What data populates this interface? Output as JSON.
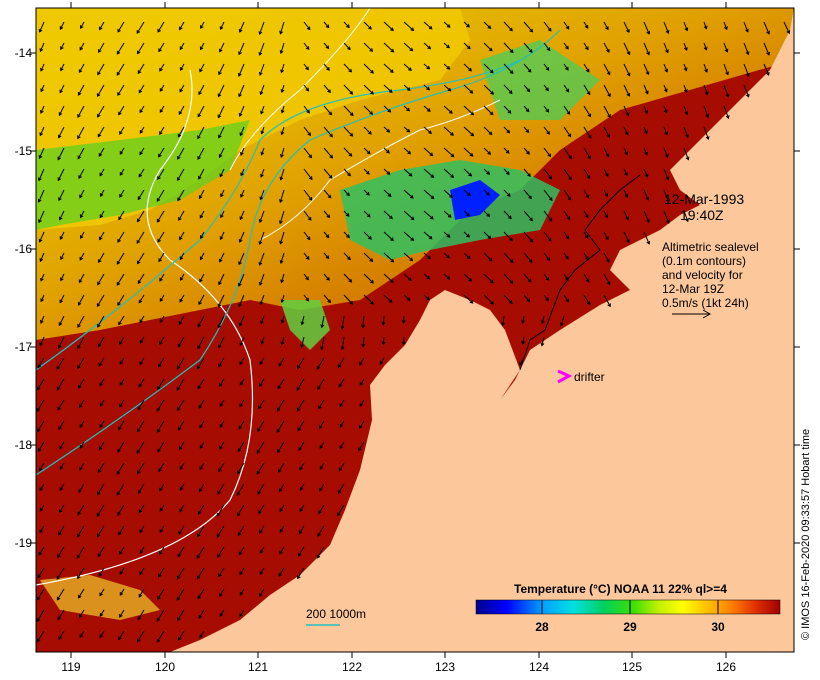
{
  "annotation": {
    "date": "12-Mar-1993",
    "time": "19:40Z",
    "legend_lines": [
      "Altimetric sealevel",
      "(0.1m contours)",
      "and velocity for",
      "12-Mar 19Z",
      "0.5m/s (1kt 24h)"
    ],
    "drifter_label": "drifter",
    "depth_label": "200  1000m"
  },
  "colorbar": {
    "title": "Temperature (°C) NOAA 11 22% ql>=4",
    "ticks": [
      "28",
      "29",
      "30"
    ],
    "colors": [
      "#00008b",
      "#0000ff",
      "#00a0ff",
      "#00e0e0",
      "#00d060",
      "#40e000",
      "#c0f000",
      "#ffff00",
      "#ffc000",
      "#ff8000",
      "#e03000",
      "#a00000"
    ]
  },
  "axes": {
    "lat_labels": [
      "-14",
      "-15",
      "-16",
      "-17",
      "-18",
      "-19"
    ],
    "lon_labels": [
      "119",
      "120",
      "121",
      "122",
      "123",
      "124",
      "125",
      "126"
    ]
  },
  "credit": "© IMOS 16-Feb-2020 09:33:57 Hobart time",
  "colors": {
    "land": "#fcc89b",
    "warm": "#a60d00",
    "drifter": "#ff00ff",
    "contour": "#ffffff",
    "isobath": "#20c0c0"
  }
}
